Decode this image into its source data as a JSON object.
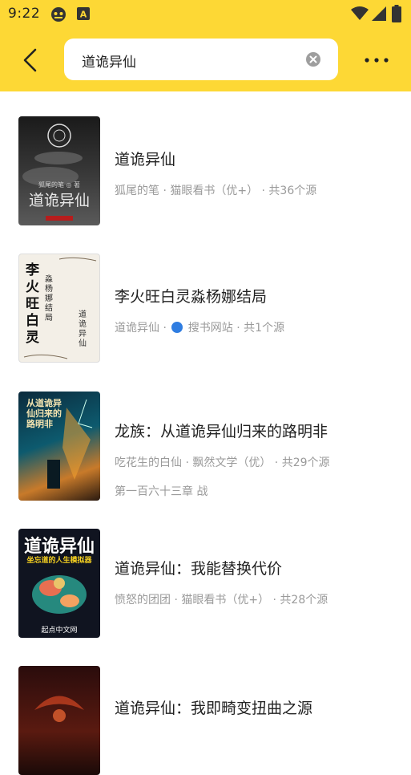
{
  "status_bar": {
    "time": "9:22",
    "notification_icons": [
      "android-robot-icon",
      "a-badge-icon"
    ],
    "system_icons": [
      "wifi-icon",
      "signal-icon",
      "battery-icon"
    ]
  },
  "search": {
    "query": "道诡异仙"
  },
  "colors": {
    "accent": "#FDD835",
    "meta_text": "#9a9a9a",
    "title_text": "#222222"
  },
  "results": [
    {
      "title": "道诡异仙",
      "meta": "狐尾的笔 · 猫眼看书（优+） · 共36个源",
      "cover_title": "道诡异仙",
      "cover_author": "狐尾的笔 ◎ 著"
    },
    {
      "title": "李火旺白灵淼杨娜结局",
      "meta_before": "道诡异仙 · ",
      "meta_after": " 搜书网站 · 共1个源",
      "cover_big": "李火旺白灵",
      "cover_sub": "淼杨娜结局",
      "cover_side": "道诡异仙"
    },
    {
      "title": "龙族：从道诡异仙归来的路明非",
      "meta": "吃花生的白仙 · 飘然文学（优） · 共29个源",
      "latest": "第一百六十三章 战",
      "cover_title": "从道诡异仙归来的路明非"
    },
    {
      "title": "道诡异仙：我能替换代价",
      "meta": "愤怒的团团 · 猫眼看书（优+） · 共28个源",
      "cover_title": "道诡异仙",
      "cover_sub": "坐忘道的人生模拟器",
      "cover_brand": "起点中文网"
    },
    {
      "title": "道诡异仙：我即畸变扭曲之源"
    }
  ]
}
